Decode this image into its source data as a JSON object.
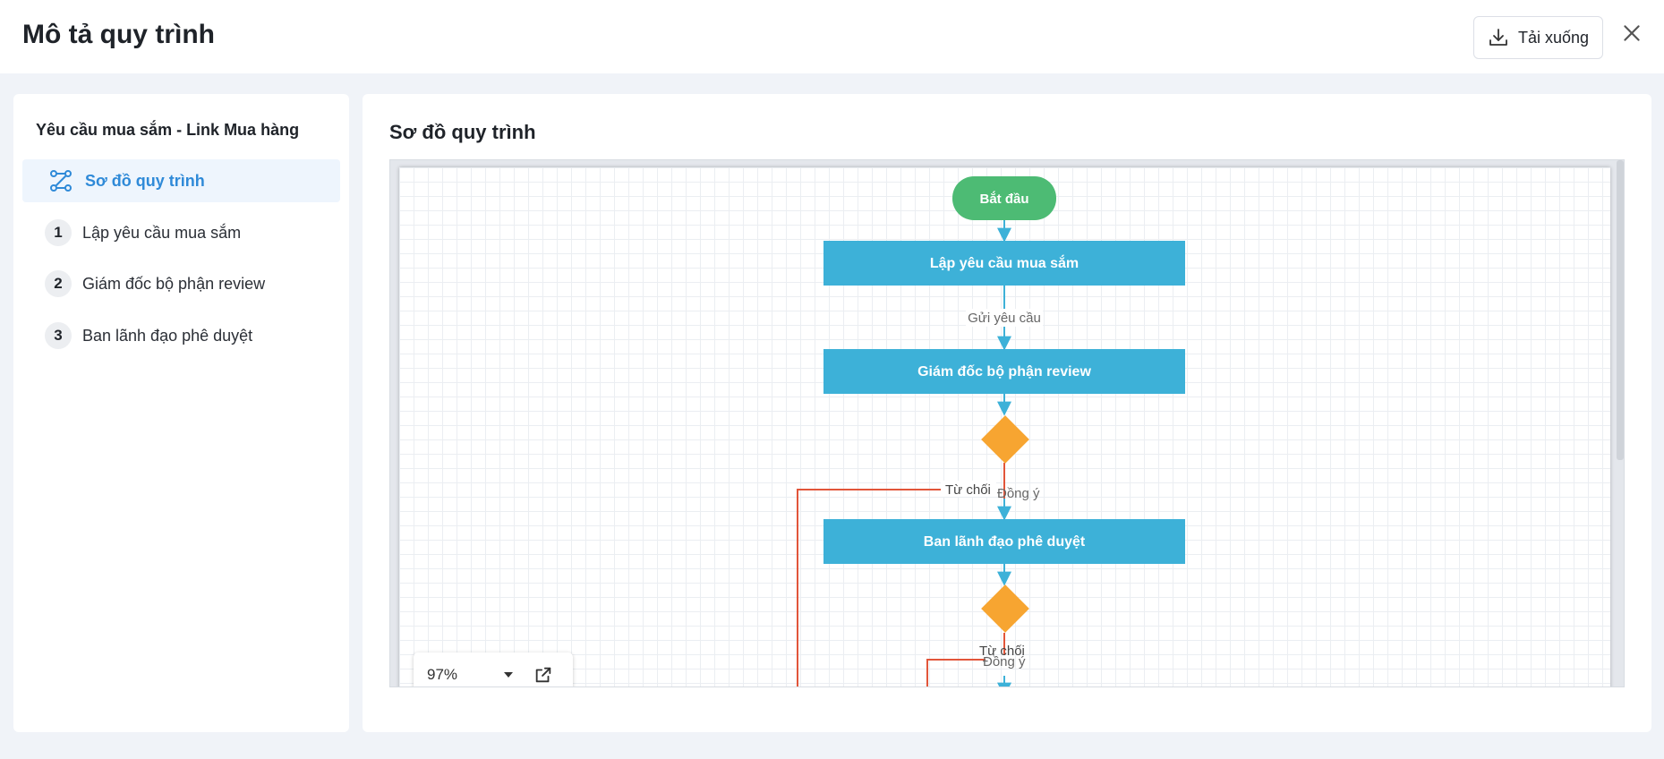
{
  "header": {
    "title": "Mô tả quy trình",
    "download_label": "Tải xuống"
  },
  "sidebar": {
    "process_name": "Yêu cầu mua sắm - Link Mua hàng",
    "diagram_item": {
      "label": "Sơ đồ quy trình",
      "icon": "workflow-icon"
    },
    "steps": [
      {
        "number": "1",
        "label": "Lập yêu cầu mua sắm"
      },
      {
        "number": "2",
        "label": "Giám đốc bộ phận review"
      },
      {
        "number": "3",
        "label": "Ban lãnh đạo phê duyệt"
      }
    ]
  },
  "main": {
    "section_title": "Sơ đồ quy trình",
    "zoom": "97%"
  },
  "diagram": {
    "start": "Bắt đầu",
    "nodes": [
      "Lập yêu cầu mua sắm",
      "Giám đốc bộ phận review",
      "Ban lãnh đạo phê duyệt"
    ],
    "edge_send": "Gửi yêu cầu",
    "reject_label": "Từ chối",
    "agree_label": "Đồng ý",
    "reject_label_2": "Từ chối",
    "agree_label_2": "Đồng ý"
  },
  "colors": {
    "start_node": "#4dbb74",
    "task_node": "#3db1d8",
    "decision": "#f7a531",
    "reject_line": "#e2553a",
    "accent": "#2f8ad8"
  }
}
